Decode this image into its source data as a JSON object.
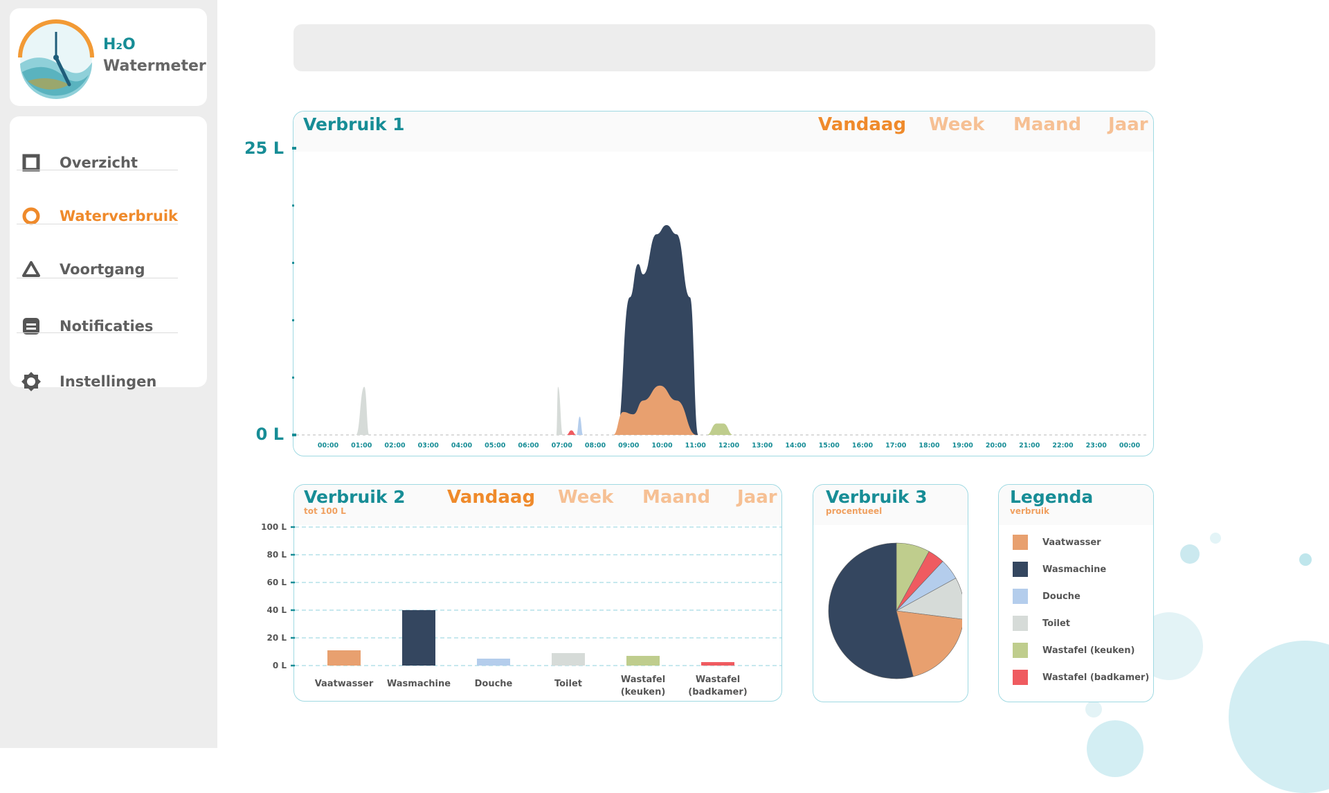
{
  "brand": {
    "title": "H₂O",
    "subtitle": "Watermeter"
  },
  "nav": [
    {
      "label": "Overzicht",
      "icon": "square-icon",
      "active": false
    },
    {
      "label": "Waterverbruik",
      "icon": "circle-icon",
      "active": true
    },
    {
      "label": "Voortgang",
      "icon": "triangle-icon",
      "active": false
    },
    {
      "label": "Notificaties",
      "icon": "notification-icon",
      "active": false
    },
    {
      "label": "Instellingen",
      "icon": "gear-icon",
      "active": false
    }
  ],
  "colors": {
    "accent": "#178d96",
    "active": "#ef8a2b",
    "inactive_tab": "#f6c094",
    "vaatwasser": "#e8a06f",
    "wasmachine": "#34465f",
    "douche": "#b4cdec",
    "toilet": "#d6dbd8",
    "wastafel_keuken": "#bfcd8d",
    "wastafel_badkamer": "#ef5b60"
  },
  "tabs": [
    "Vandaag",
    "Week",
    "Maand",
    "Jaar"
  ],
  "card1": {
    "title": "Verbruik 1",
    "ymax_label": "25 L",
    "ymin_label": "0 L"
  },
  "card2": {
    "title": "Verbruik 2",
    "subtitle": "tot 100 L"
  },
  "card3": {
    "title": "Verbruik 3",
    "subtitle": "procentueel"
  },
  "legend": {
    "title": "Legenda",
    "subtitle": "verbruik",
    "items": [
      "Vaatwasser",
      "Wasmachine",
      "Douche",
      "Toilet",
      "Wastafel (keuken)",
      "Wastafel (badkamer)"
    ]
  },
  "chart_data": [
    {
      "type": "area",
      "title": "Verbruik 1",
      "x": [
        "00:00",
        "01:00",
        "02:00",
        "03:00",
        "04:00",
        "05:00",
        "06:00",
        "07:00",
        "08:00",
        "09:00",
        "10:00",
        "11:00",
        "12:00",
        "13:00",
        "14:00",
        "15:00",
        "16:00",
        "17:00",
        "18:00",
        "19:00",
        "20:00",
        "21:00",
        "22:00",
        "23:00",
        "00:00"
      ],
      "ylim": [
        0,
        25
      ],
      "ytick_labels": [
        "0 L",
        "25 L"
      ],
      "series": [
        {
          "name": "Toilet",
          "points": [
            [
              1.0,
              0
            ],
            [
              1.25,
              4.2
            ],
            [
              1.4,
              0
            ],
            [
              7.0,
              0
            ],
            [
              7.05,
              4.2
            ],
            [
              7.2,
              0
            ]
          ]
        },
        {
          "name": "Douche",
          "points": [
            [
              7.6,
              0
            ],
            [
              7.7,
              1.6
            ],
            [
              7.8,
              0
            ]
          ]
        },
        {
          "name": "Wastafel (badkamer)",
          "points": [
            [
              7.3,
              0
            ],
            [
              7.45,
              0.4
            ],
            [
              7.6,
              0
            ]
          ]
        },
        {
          "name": "Wasmachine",
          "points": [
            [
              8.8,
              0
            ],
            [
              9.2,
              12
            ],
            [
              9.45,
              14.9
            ],
            [
              9.6,
              14
            ],
            [
              10.0,
              17.5
            ],
            [
              10.3,
              18.3
            ],
            [
              10.6,
              17.5
            ],
            [
              11.0,
              12
            ],
            [
              11.25,
              0
            ]
          ]
        },
        {
          "name": "Vaatwasser",
          "points": [
            [
              8.7,
              0
            ],
            [
              9.0,
              2
            ],
            [
              9.3,
              1.8
            ],
            [
              9.6,
              3
            ],
            [
              10.1,
              4.3
            ],
            [
              10.6,
              3
            ],
            [
              11.2,
              0
            ]
          ]
        },
        {
          "name": "Wastafel (keuken)",
          "points": [
            [
              11.5,
              0
            ],
            [
              11.8,
              1
            ],
            [
              12.0,
              1
            ],
            [
              12.3,
              0
            ]
          ]
        }
      ]
    },
    {
      "type": "bar",
      "title": "Verbruik 2",
      "categories": [
        "Vaatwasser",
        "Wasmachine",
        "Douche",
        "Toilet",
        "Wastafel\n(keuken)",
        "Wastafel\n(badkamer)"
      ],
      "values": [
        11,
        40,
        5,
        9,
        7,
        2.5
      ],
      "ylim": [
        0,
        100
      ],
      "ytick_labels": [
        "0 L",
        "20 L",
        "40 L",
        "60 L",
        "80 L",
        "100 L"
      ]
    },
    {
      "type": "pie",
      "title": "Verbruik 3",
      "labels": [
        "Wastafel (keuken)",
        "Wastafel (badkamer)",
        "Douche",
        "Toilet",
        "Vaatwasser",
        "Wasmachine"
      ],
      "values": [
        8,
        4,
        5,
        10,
        19,
        54
      ]
    }
  ]
}
